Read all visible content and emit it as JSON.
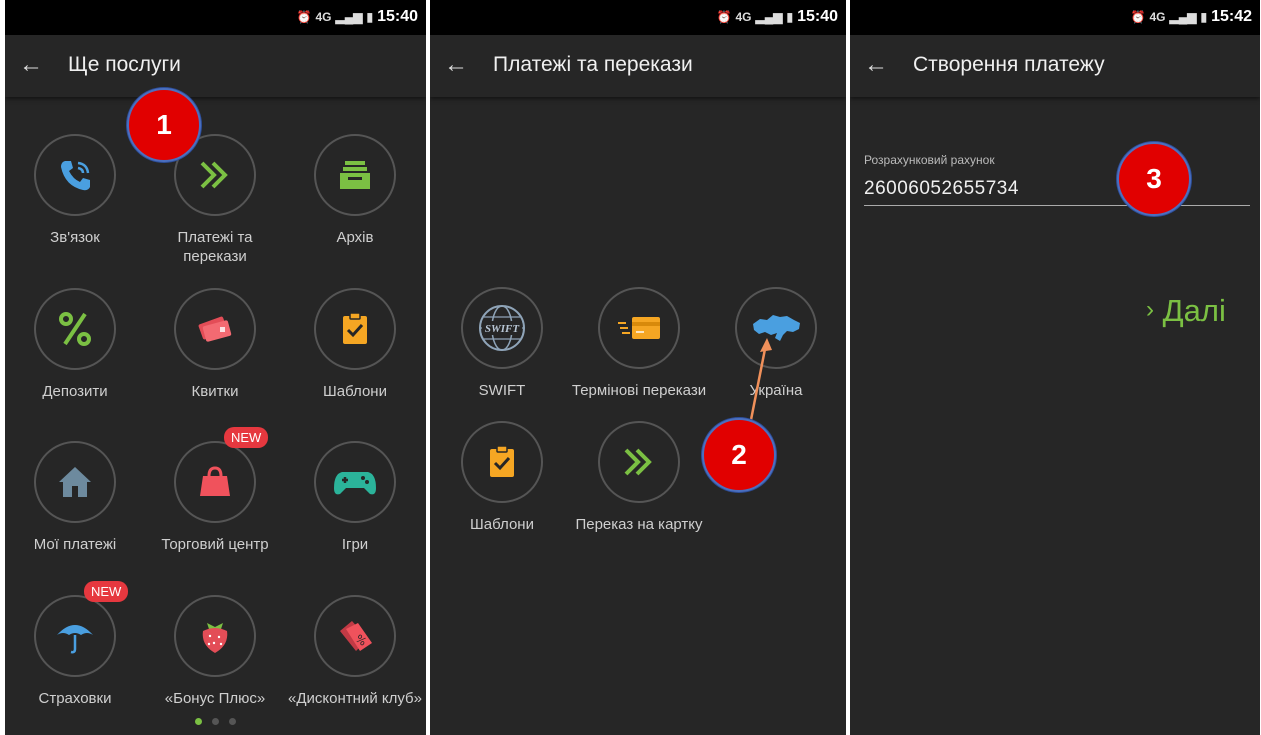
{
  "status_bar": {
    "net": "4G",
    "time_1": "15:40",
    "time_2": "15:40",
    "time_3": "15:42"
  },
  "screen1": {
    "title": "Ще послуги",
    "items": [
      {
        "label": "Зв'язок",
        "icon": "phone-icon"
      },
      {
        "label": "Платежі та перекази",
        "icon": "double-chevron-icon"
      },
      {
        "label": "Архів",
        "icon": "archive-tray-icon"
      },
      {
        "label": "Депозити",
        "icon": "percent-icon"
      },
      {
        "label": "Квитки",
        "icon": "tickets-icon"
      },
      {
        "label": "Шаблони",
        "icon": "clipboard-check-icon"
      },
      {
        "label": "Мої платежі",
        "icon": "house-icon"
      },
      {
        "label": "Торговий центр",
        "icon": "shopping-bag-icon",
        "badge": "NEW"
      },
      {
        "label": "Ігри",
        "icon": "gamepad-icon"
      },
      {
        "label": "Страховки",
        "icon": "umbrella-icon",
        "badge": "NEW"
      },
      {
        "label": "«Бонус Плюс»",
        "icon": "strawberry-icon"
      },
      {
        "label": "«Дисконтний клуб»",
        "icon": "discount-tags-icon"
      }
    ],
    "marker": "1"
  },
  "screen2": {
    "title": "Платежі та перекази",
    "items": [
      {
        "label": "SWIFT",
        "icon": "swift-globe-icon"
      },
      {
        "label": "Термінові перекази",
        "icon": "fast-card-icon"
      },
      {
        "label": "Україна",
        "icon": "ukraine-map-icon"
      },
      {
        "label": "Шаблони",
        "icon": "clipboard-check-icon"
      },
      {
        "label": "Переказ на картку",
        "icon": "double-chevron-icon"
      }
    ],
    "swift_text": "SWIFT",
    "marker": "2"
  },
  "screen3": {
    "title": "Створення платежу",
    "field_label": "Розрахунковий рахунок",
    "field_value": "26006052655734",
    "next_label": "Далі",
    "marker": "3"
  },
  "colors": {
    "accent_green": "#7bc043",
    "marker_red": "#e10000",
    "badge_red": "#e6383f",
    "panel_bg": "#262626"
  }
}
